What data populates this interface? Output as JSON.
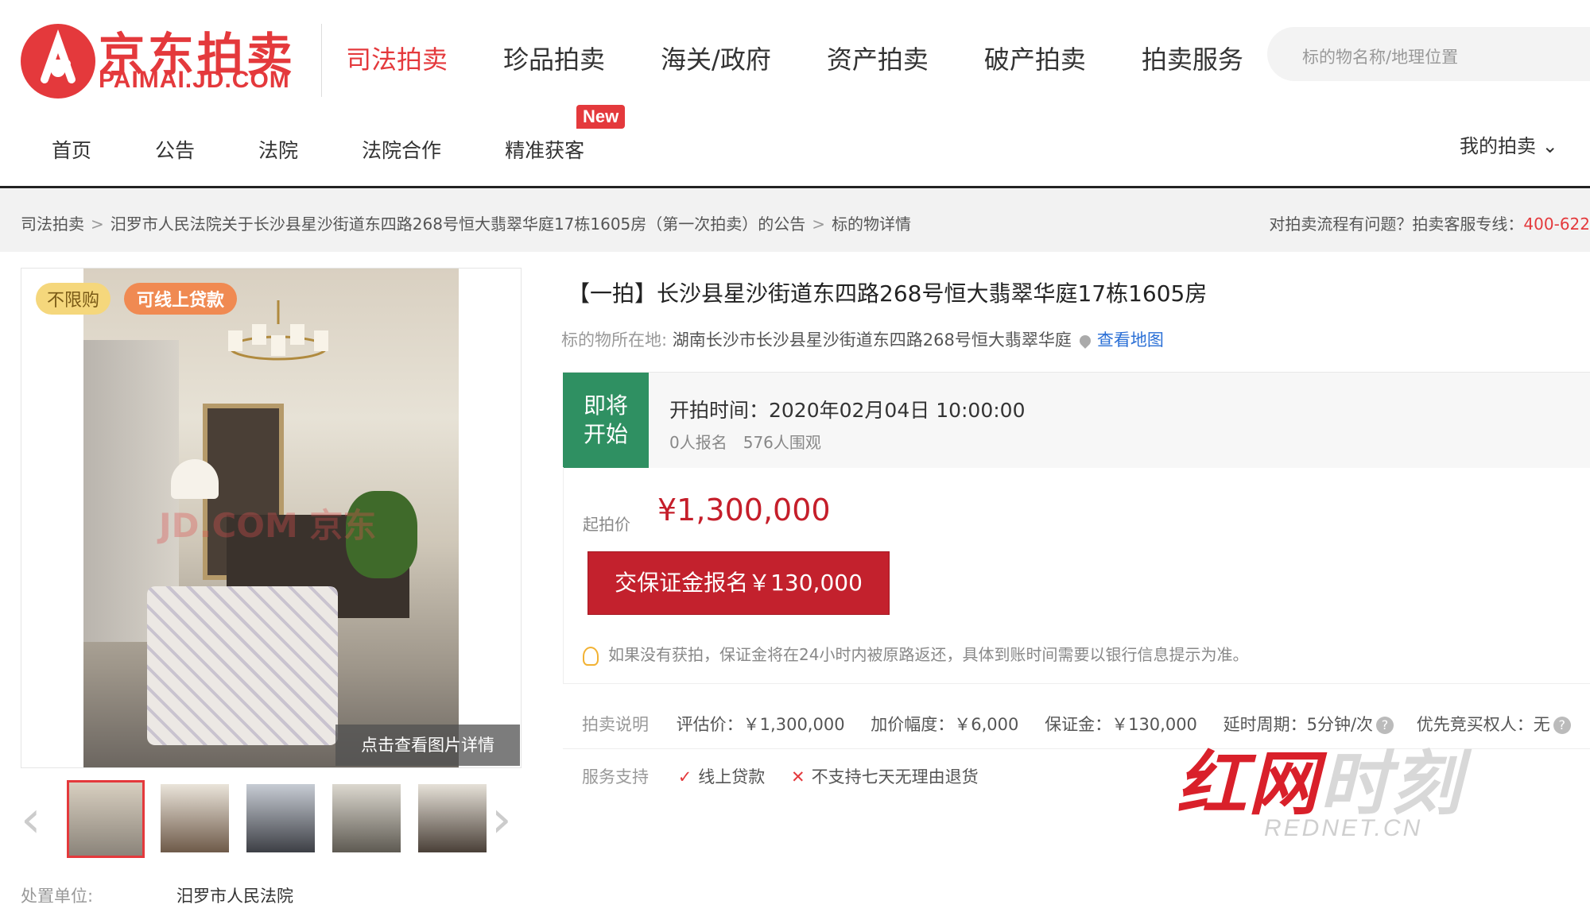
{
  "header": {
    "logo_cn": "京东拍卖",
    "logo_en": "PAIMAI.JD.COM",
    "nav": [
      "司法拍卖",
      "珍品拍卖",
      "海关/政府",
      "资产拍卖",
      "破产拍卖",
      "拍卖服务"
    ],
    "search_placeholder": "标的物名称/地理位置"
  },
  "subnav": {
    "items": [
      "首页",
      "公告",
      "法院",
      "法院合作",
      "精准获客"
    ],
    "new_badge": "New",
    "my_auction": "我的拍卖"
  },
  "breadcrumb": {
    "items": [
      "司法拍卖",
      "汨罗市人民法院关于长沙县星沙街道东四路268号恒大翡翠华庭17栋1605房（第一次拍卖）的公告",
      "标的物详情"
    ],
    "help_text": "对拍卖流程有问题？拍卖客服专线：",
    "hotline": "400-622"
  },
  "gallery": {
    "tags": [
      "不限购",
      "可线上贷款"
    ],
    "watermark": "JD.COM 京东",
    "photo_hint": "点击查看图片详情",
    "owner_label": "处置单位:",
    "owner_value": "汨罗市人民法院"
  },
  "detail": {
    "title": "【一拍】长沙县星沙街道东四路268号恒大翡翠华庭17栋1605房",
    "location_label": "标的物所在地:",
    "location_value": "湖南长沙市长沙县星沙街道东四路268号恒大翡翠华庭",
    "map_link": "查看地图",
    "status_line1": "即将",
    "status_line2": "开始",
    "start_time": "开拍时间：2020年02月04日 10:00:00",
    "counts": "0人报名　576人围观",
    "price_label": "起拍价",
    "price": "¥1,300,000",
    "deposit_button": "交保证金报名￥130,000",
    "tip": "如果没有获拍，保证金将在24小时内被原路返还，具体到账时间需要以银行信息提示为准。",
    "info_label": "拍卖说明",
    "appraisal": "评估价：￥1,300,000",
    "increment": "加价幅度：￥6,000",
    "deposit": "保证金：￥130,000",
    "delay": "延时周期：5分钟/次",
    "priority": "优先竞买权人：无",
    "service_label": "服务支持",
    "service_yes": "线上贷款",
    "service_no": "不支持七天无理由退货"
  },
  "rednet": {
    "brand": "红网",
    "brand2": "时刻",
    "domain": "REDNET.CN"
  },
  "colors": {
    "brand_red": "#e4393c",
    "status_green": "#2f9062",
    "price_red": "#c51e2a"
  }
}
